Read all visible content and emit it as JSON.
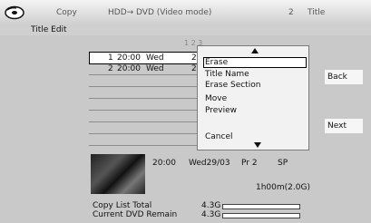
{
  "header": {
    "menu_title": "Copy",
    "mode": "HDD→ DVD (Video mode)",
    "page_number": "2",
    "page_label": "Title",
    "section": "Title Edit",
    "page_indicator": "1 2 3"
  },
  "titles": [
    {
      "num": "1",
      "time": "20:00",
      "day": "Wed",
      "extra": "2"
    },
    {
      "num": "2",
      "time": "20:00",
      "day": "Wed",
      "extra": "2"
    }
  ],
  "context_menu": {
    "items": [
      "Erase",
      "Title Name",
      "Erase Section",
      "Move",
      "Preview"
    ],
    "cancel": "Cancel",
    "selected": "Erase"
  },
  "buttons": {
    "back": "Back",
    "next": "Next"
  },
  "details": {
    "time": "20:00",
    "date": "Wed29/03",
    "program": "Pr 2",
    "speed": "SP",
    "duration": "1h00m(2.0G)"
  },
  "totals": {
    "copy_list_label": "Copy List Total",
    "copy_list_value": "4.3G",
    "copy_list_fraction": 0,
    "dvd_remain_label": "Current DVD Remain",
    "dvd_remain_value": "4.3G",
    "dvd_remain_fraction": 0
  },
  "icons": {
    "disc": "disc-icon",
    "up": "arrow-up-icon",
    "down": "arrow-down-icon"
  }
}
